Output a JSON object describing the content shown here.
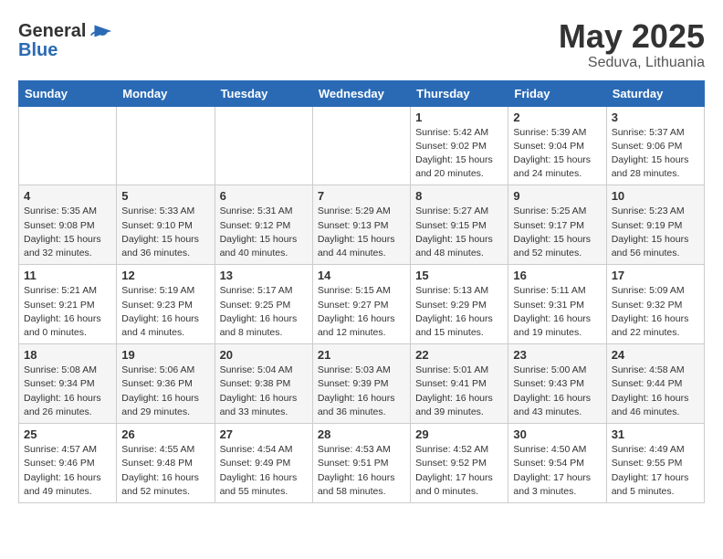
{
  "header": {
    "logo_general": "General",
    "logo_blue": "Blue",
    "month": "May 2025",
    "location": "Seduva, Lithuania"
  },
  "weekdays": [
    "Sunday",
    "Monday",
    "Tuesday",
    "Wednesday",
    "Thursday",
    "Friday",
    "Saturday"
  ],
  "weeks": [
    [
      {
        "day": "",
        "info": ""
      },
      {
        "day": "",
        "info": ""
      },
      {
        "day": "",
        "info": ""
      },
      {
        "day": "",
        "info": ""
      },
      {
        "day": "1",
        "info": "Sunrise: 5:42 AM\nSunset: 9:02 PM\nDaylight: 15 hours\nand 20 minutes."
      },
      {
        "day": "2",
        "info": "Sunrise: 5:39 AM\nSunset: 9:04 PM\nDaylight: 15 hours\nand 24 minutes."
      },
      {
        "day": "3",
        "info": "Sunrise: 5:37 AM\nSunset: 9:06 PM\nDaylight: 15 hours\nand 28 minutes."
      }
    ],
    [
      {
        "day": "4",
        "info": "Sunrise: 5:35 AM\nSunset: 9:08 PM\nDaylight: 15 hours\nand 32 minutes."
      },
      {
        "day": "5",
        "info": "Sunrise: 5:33 AM\nSunset: 9:10 PM\nDaylight: 15 hours\nand 36 minutes."
      },
      {
        "day": "6",
        "info": "Sunrise: 5:31 AM\nSunset: 9:12 PM\nDaylight: 15 hours\nand 40 minutes."
      },
      {
        "day": "7",
        "info": "Sunrise: 5:29 AM\nSunset: 9:13 PM\nDaylight: 15 hours\nand 44 minutes."
      },
      {
        "day": "8",
        "info": "Sunrise: 5:27 AM\nSunset: 9:15 PM\nDaylight: 15 hours\nand 48 minutes."
      },
      {
        "day": "9",
        "info": "Sunrise: 5:25 AM\nSunset: 9:17 PM\nDaylight: 15 hours\nand 52 minutes."
      },
      {
        "day": "10",
        "info": "Sunrise: 5:23 AM\nSunset: 9:19 PM\nDaylight: 15 hours\nand 56 minutes."
      }
    ],
    [
      {
        "day": "11",
        "info": "Sunrise: 5:21 AM\nSunset: 9:21 PM\nDaylight: 16 hours\nand 0 minutes."
      },
      {
        "day": "12",
        "info": "Sunrise: 5:19 AM\nSunset: 9:23 PM\nDaylight: 16 hours\nand 4 minutes."
      },
      {
        "day": "13",
        "info": "Sunrise: 5:17 AM\nSunset: 9:25 PM\nDaylight: 16 hours\nand 8 minutes."
      },
      {
        "day": "14",
        "info": "Sunrise: 5:15 AM\nSunset: 9:27 PM\nDaylight: 16 hours\nand 12 minutes."
      },
      {
        "day": "15",
        "info": "Sunrise: 5:13 AM\nSunset: 9:29 PM\nDaylight: 16 hours\nand 15 minutes."
      },
      {
        "day": "16",
        "info": "Sunrise: 5:11 AM\nSunset: 9:31 PM\nDaylight: 16 hours\nand 19 minutes."
      },
      {
        "day": "17",
        "info": "Sunrise: 5:09 AM\nSunset: 9:32 PM\nDaylight: 16 hours\nand 22 minutes."
      }
    ],
    [
      {
        "day": "18",
        "info": "Sunrise: 5:08 AM\nSunset: 9:34 PM\nDaylight: 16 hours\nand 26 minutes."
      },
      {
        "day": "19",
        "info": "Sunrise: 5:06 AM\nSunset: 9:36 PM\nDaylight: 16 hours\nand 29 minutes."
      },
      {
        "day": "20",
        "info": "Sunrise: 5:04 AM\nSunset: 9:38 PM\nDaylight: 16 hours\nand 33 minutes."
      },
      {
        "day": "21",
        "info": "Sunrise: 5:03 AM\nSunset: 9:39 PM\nDaylight: 16 hours\nand 36 minutes."
      },
      {
        "day": "22",
        "info": "Sunrise: 5:01 AM\nSunset: 9:41 PM\nDaylight: 16 hours\nand 39 minutes."
      },
      {
        "day": "23",
        "info": "Sunrise: 5:00 AM\nSunset: 9:43 PM\nDaylight: 16 hours\nand 43 minutes."
      },
      {
        "day": "24",
        "info": "Sunrise: 4:58 AM\nSunset: 9:44 PM\nDaylight: 16 hours\nand 46 minutes."
      }
    ],
    [
      {
        "day": "25",
        "info": "Sunrise: 4:57 AM\nSunset: 9:46 PM\nDaylight: 16 hours\nand 49 minutes."
      },
      {
        "day": "26",
        "info": "Sunrise: 4:55 AM\nSunset: 9:48 PM\nDaylight: 16 hours\nand 52 minutes."
      },
      {
        "day": "27",
        "info": "Sunrise: 4:54 AM\nSunset: 9:49 PM\nDaylight: 16 hours\nand 55 minutes."
      },
      {
        "day": "28",
        "info": "Sunrise: 4:53 AM\nSunset: 9:51 PM\nDaylight: 16 hours\nand 58 minutes."
      },
      {
        "day": "29",
        "info": "Sunrise: 4:52 AM\nSunset: 9:52 PM\nDaylight: 17 hours\nand 0 minutes."
      },
      {
        "day": "30",
        "info": "Sunrise: 4:50 AM\nSunset: 9:54 PM\nDaylight: 17 hours\nand 3 minutes."
      },
      {
        "day": "31",
        "info": "Sunrise: 4:49 AM\nSunset: 9:55 PM\nDaylight: 17 hours\nand 5 minutes."
      }
    ]
  ]
}
